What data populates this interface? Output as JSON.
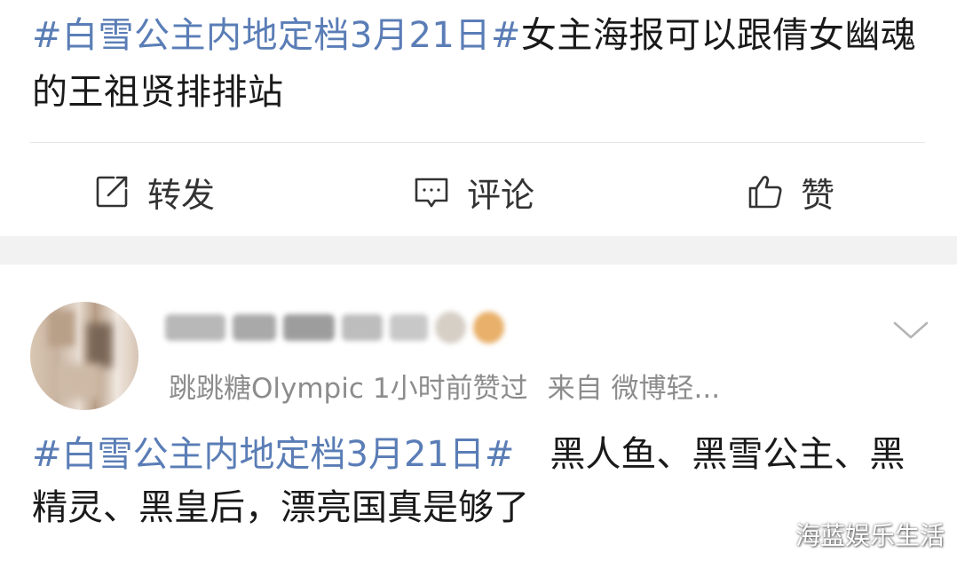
{
  "post": {
    "topic": "#白雪公主内地定档3月21日#",
    "text": "女主海报可以跟倩女幽魂的王祖贤排排站"
  },
  "actions": {
    "repost_label": "转发",
    "comment_label": "评论",
    "like_label": "赞"
  },
  "comment": {
    "liked_by": "跳跳糖Olympic",
    "liked_time": "1小时前赞过",
    "source": "来自 微博轻...",
    "topic": "#白雪公主内地定档3月21日#",
    "text": "黑人鱼、黑雪公主、黑精灵、黑皇后，漂亮国真是够了"
  },
  "watermark": "海蓝娱乐生活"
}
